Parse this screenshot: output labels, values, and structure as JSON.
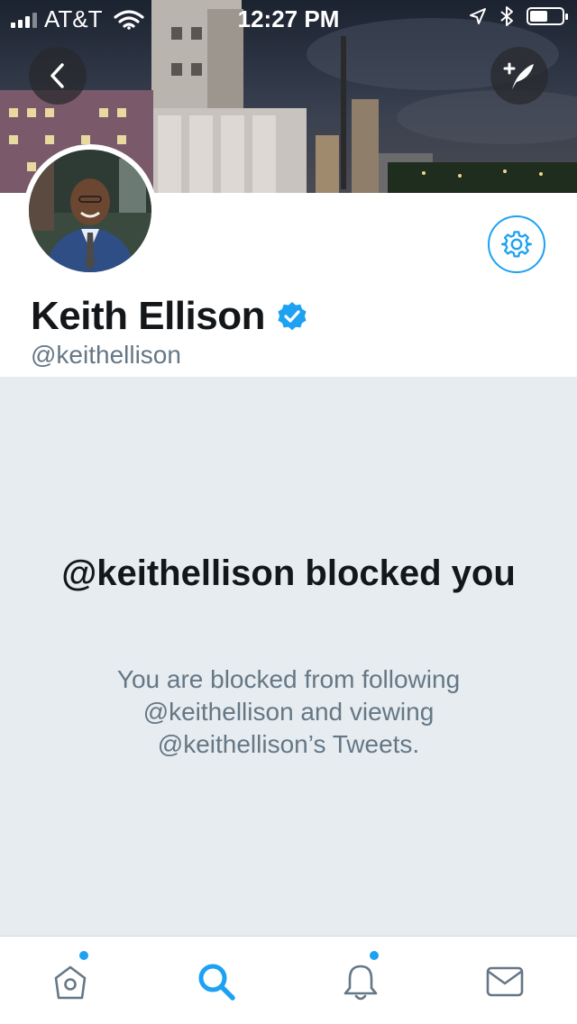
{
  "status_bar": {
    "carrier": "AT&T",
    "time": "12:27 PM",
    "battery_level": 0.55
  },
  "header": {
    "back_icon": "chevron-left-icon",
    "compose_icon": "compose-tweet-icon"
  },
  "profile": {
    "name": "Keith Ellison",
    "handle": "@keithellison",
    "verified": true,
    "settings_icon": "gear-icon"
  },
  "blocked": {
    "title": "@keithellison blocked you",
    "message": "You are blocked from following @keithellison and viewing @keithellison’s Tweets."
  },
  "tab_bar": {
    "tabs": [
      {
        "icon": "home-icon",
        "active": false,
        "notification_dot": true
      },
      {
        "icon": "search-icon",
        "active": true,
        "notification_dot": false
      },
      {
        "icon": "notifications-bell-icon",
        "active": false,
        "notification_dot": true
      },
      {
        "icon": "messages-envelope-icon",
        "active": false,
        "notification_dot": false
      }
    ]
  },
  "colors": {
    "accent": "#1da1f2",
    "panel_background": "#e6ecf0",
    "text_primary": "#14171a",
    "text_secondary": "#657786"
  }
}
